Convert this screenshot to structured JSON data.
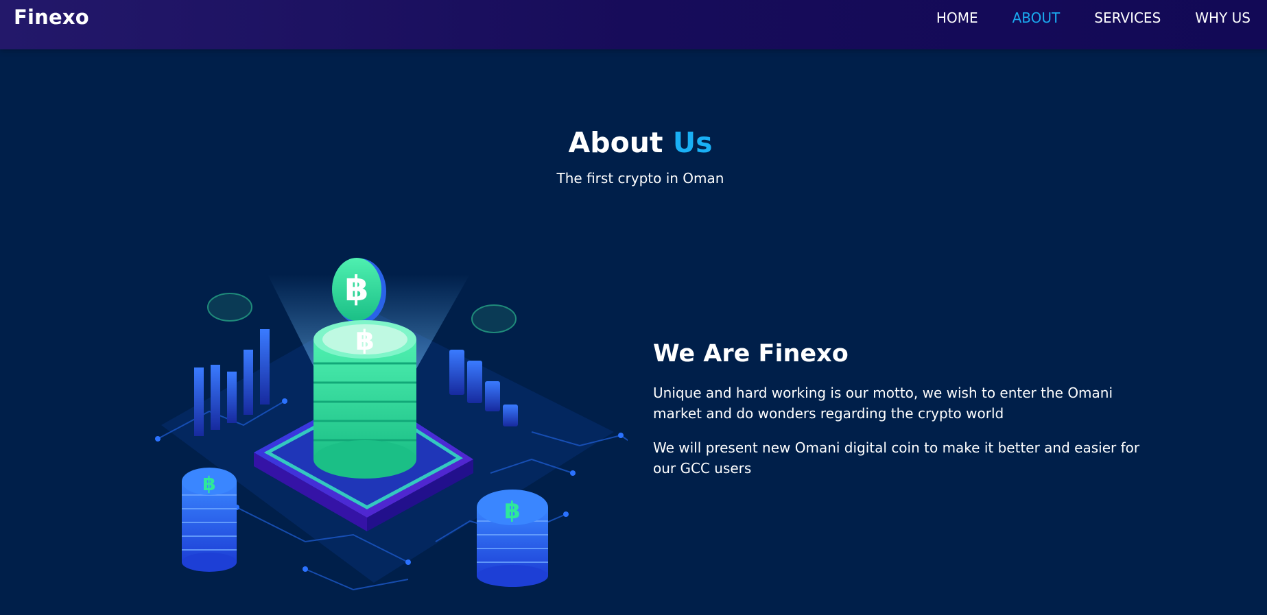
{
  "brand": "Finexo",
  "nav": {
    "home": "HOME",
    "about": "ABOUT",
    "services": "SERVICES",
    "why_us": "WHY US",
    "active": "ABOUT"
  },
  "hero": {
    "title_main": "About",
    "title_accent": "Us",
    "subtitle": "The first crypto in Oman"
  },
  "about": {
    "heading": "We Are Finexo",
    "paragraph1": "Unique and hard working is our motto, we wish to enter the Omani market and do wonders regarding the crypto world",
    "paragraph2": "We will present new Omani digital coin to make it better and easier for our GCC users"
  },
  "illustration": {
    "icon": "crypto-coin-illustration"
  },
  "colors": {
    "background": "#001f4a",
    "navbar": "#170c5a",
    "accent": "#1ab0f5",
    "coin_green": "#2ee89b",
    "chart_blue": "#2a5cf0"
  }
}
